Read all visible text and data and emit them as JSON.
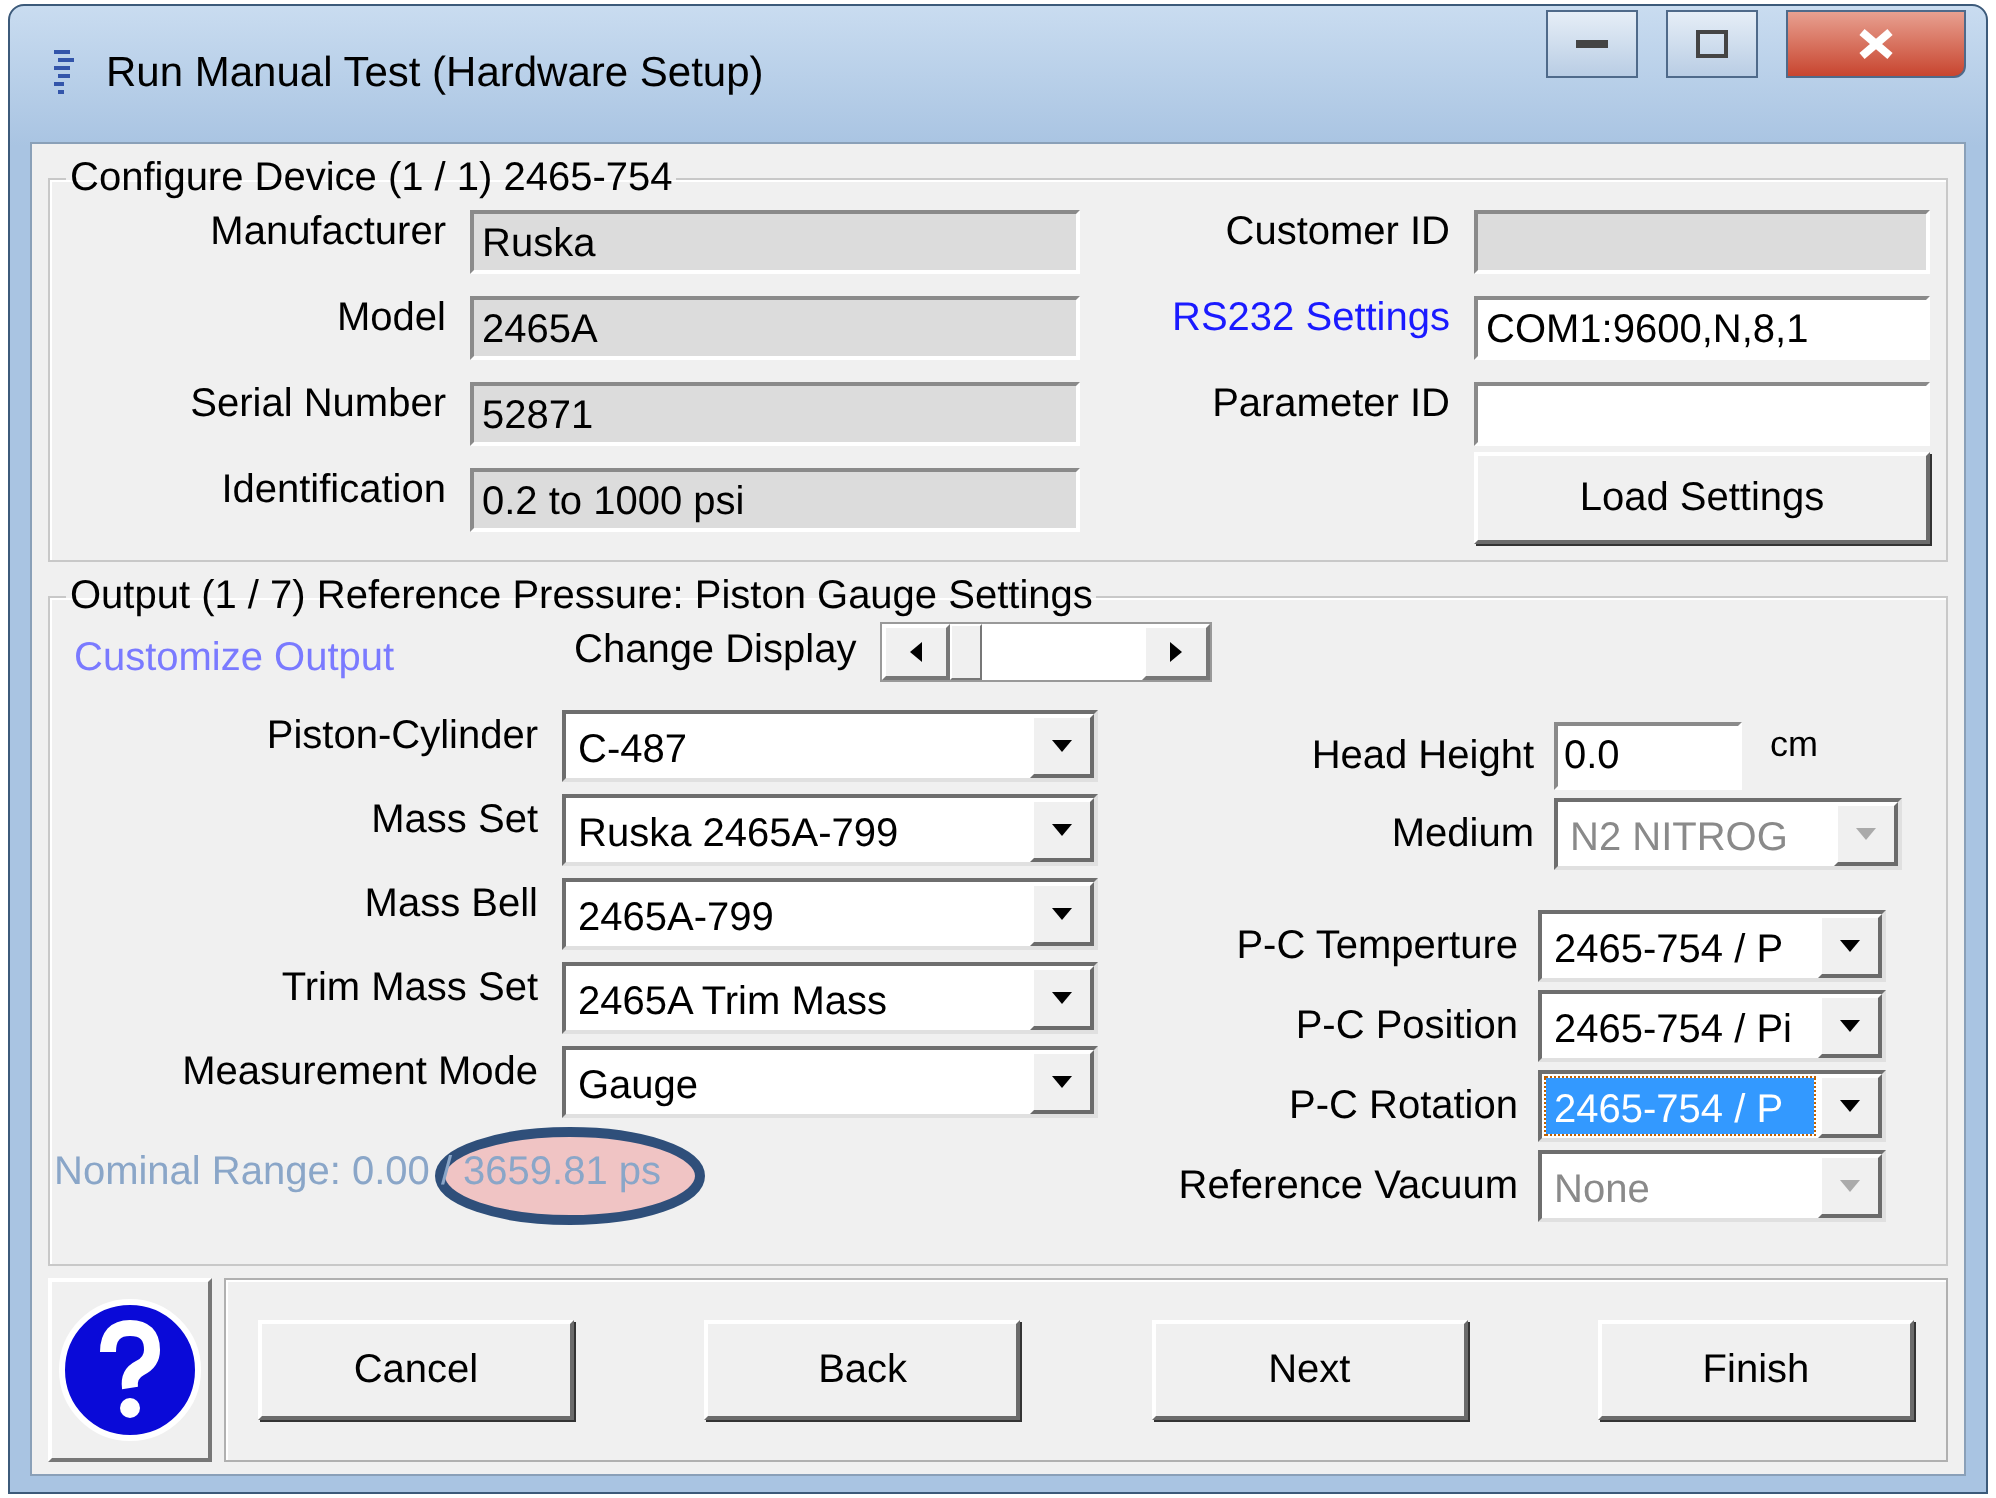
{
  "window": {
    "title": "Run Manual Test (Hardware Setup)"
  },
  "device": {
    "legend": "Configure Device (1 / 1) 2465-754",
    "left_fields": [
      {
        "label": "Manufacturer",
        "value": "Ruska",
        "readonly": true
      },
      {
        "label": "Model",
        "value": "2465A",
        "readonly": true
      },
      {
        "label": "Serial Number",
        "value": "52871",
        "readonly": true
      },
      {
        "label": "Identification",
        "value": "0.2 to 1000 psi",
        "readonly": true
      }
    ],
    "right_fields": [
      {
        "label": "Customer ID",
        "kind": "text",
        "readonly": true
      },
      {
        "label": "RS232 Settings",
        "kind": "link",
        "value": "COM1:9600,N,8,1",
        "readonly": false
      },
      {
        "label": "Parameter ID",
        "kind": "text",
        "readonly": false
      }
    ],
    "load_button": "Load Settings"
  },
  "output": {
    "legend": "Output (1 / 7) Reference Pressure: Piston Gauge Settings",
    "customize_link": "Customize Output",
    "change_display": "Change Display",
    "left_combos": [
      {
        "label": "Piston-Cylinder",
        "value": "C-487"
      },
      {
        "label": "Mass Set",
        "value": "Ruska 2465A-799"
      },
      {
        "label": "Mass Bell",
        "value": "2465A-799"
      },
      {
        "label": "Trim Mass Set",
        "value": "2465A Trim Mass"
      },
      {
        "label": "Measurement Mode",
        "value": "Gauge"
      }
    ],
    "nominal_range": "Nominal Range: 0.00 / 3659.81 ps",
    "head_height": {
      "label": "Head Height",
      "value": "0.0",
      "unit": "cm"
    },
    "medium": {
      "label": "Medium",
      "value": "N2  NITROG",
      "disabled": true
    },
    "right_combos": [
      {
        "label": "P-C Temperture",
        "value": "2465-754 / P",
        "selected": false,
        "disabled": false
      },
      {
        "label": "P-C Position",
        "value": "2465-754 / Pi",
        "selected": false,
        "disabled": false
      },
      {
        "label": "P-C Rotation",
        "value": "2465-754 / P",
        "selected": true,
        "disabled": false
      },
      {
        "label": "Reference Vacuum",
        "value": "None",
        "selected": false,
        "disabled": true
      }
    ]
  },
  "buttons": [
    "Cancel",
    "Back",
    "Next",
    "Finish"
  ]
}
